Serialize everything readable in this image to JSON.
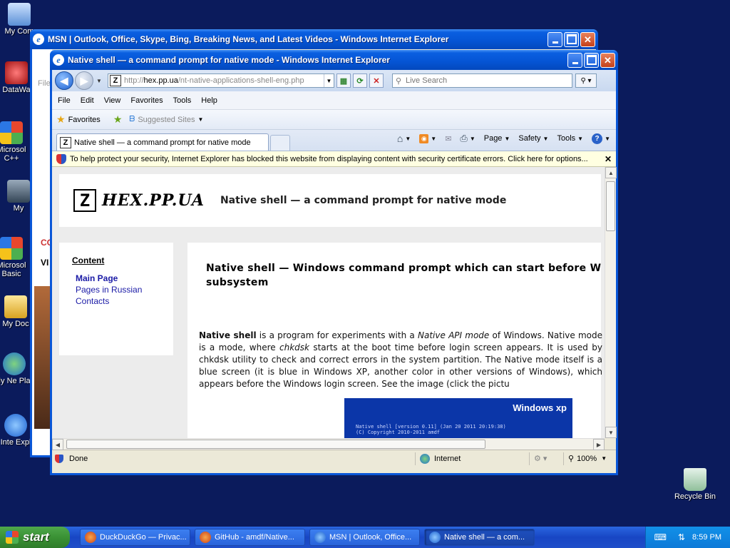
{
  "desktop": {
    "icons": [
      {
        "label": "My Com",
        "name": "my-computer-icon"
      },
      {
        "label": "DataWa",
        "name": "datawatch-icon"
      },
      {
        "label": "Microsol C++",
        "name": "microsoft-cpp-icon"
      },
      {
        "label": "My",
        "name": "my-music-icon"
      },
      {
        "label": "Microsol Basic",
        "name": "microsoft-basic-icon"
      },
      {
        "label": "My Doc",
        "name": "my-documents-icon"
      },
      {
        "label": "My Ne Plac",
        "name": "my-network-places-icon"
      },
      {
        "label": "Inte Expl",
        "name": "internet-explorer-icon"
      }
    ],
    "recycle_bin": "Recycle Bin"
  },
  "back_window": {
    "title": "MSN | Outlook, Office, Skype, Bing, Breaking News, and Latest Videos - Windows Internet Explorer",
    "peek_text": [
      "File",
      "CO",
      "VI"
    ]
  },
  "ie": {
    "title": "Native shell — a command prompt for native mode - Windows Internet Explorer",
    "address": {
      "scheme": "http://",
      "host": "hex.pp.ua",
      "path": "/nt-native-applications-shell-eng.php"
    },
    "search_placeholder": "Live Search",
    "menu": [
      "File",
      "Edit",
      "View",
      "Favorites",
      "Tools",
      "Help"
    ],
    "favorites_label": "Favorites",
    "suggested_sites": "Suggested Sites",
    "tab_title": "Native shell — a command prompt for native mode",
    "commands": [
      "Page",
      "Safety",
      "Tools"
    ],
    "info_bar": "To help protect your security, Internet Explorer has blocked this website from displaying content with security certificate errors. Click here for options...",
    "status": {
      "text": "Done",
      "zone": "Internet",
      "zoom": "100%"
    }
  },
  "page": {
    "logo_mark": "Z",
    "logo_text": "HEX.PP.UA",
    "subtitle": "Native shell — a command prompt for native mode",
    "sidebar": {
      "heading": "Content",
      "links": [
        "Main Page",
        "Pages in Russian",
        "Contacts"
      ]
    },
    "main_heading": "Native shell — Windows command prompt which can start before W subsystem",
    "paragraph": {
      "b1": "Native shell",
      "t1": " is a program for experiments with a ",
      "i1": "Native API mode",
      "t2": " of Windows. Native mode is a mode, where ",
      "i2": "chkdsk",
      "t3": " starts at the boot time before login screen appears. It is used by chkdsk utility to check and correct errors in the system partition. The Native mode itself is a blue screen (it is blue in Windows XP, another color in other versions of Windows), which appears before the Windows login screen. See the image (click the pictu"
    },
    "screenshot": {
      "logo": "Windows xp",
      "line1": "Native shell [version 0.11] (Jan 20 2011 20:19:38)",
      "line2": "(C) Copyright 2010-2011 amdf"
    }
  },
  "taskbar": {
    "start": "start",
    "tasks": [
      "DuckDuckGo — Privac...",
      "GitHub - amdf/Native...",
      "MSN | Outlook, Office...",
      "Native shell — a com..."
    ],
    "clock": "8:59 PM"
  }
}
